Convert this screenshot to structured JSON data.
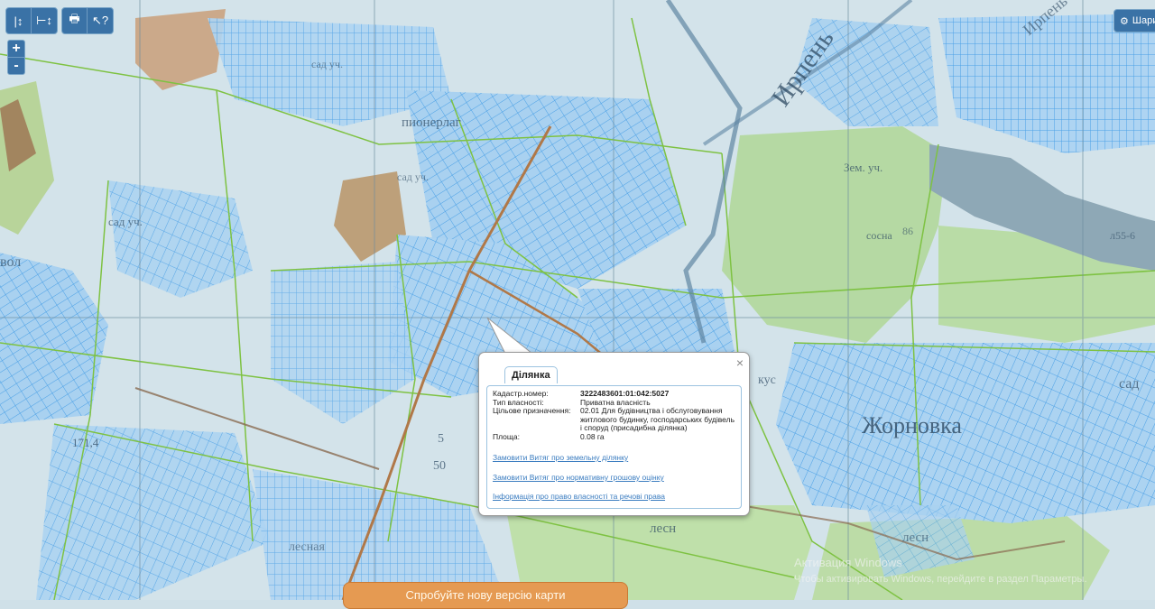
{
  "map": {
    "labels": {
      "river": "Ирпень",
      "river2": "Ирпень",
      "village": "Жорновка",
      "pioneer": "пионерлаг",
      "sad": "сад уч.",
      "sad2": "сад уч.",
      "sad3": "сад уч.",
      "zem": "Зем. уч.",
      "forest": "лесн",
      "forest2": "лесн",
      "sosna": "сосна",
      "elev": "171,4",
      "vol": "вол",
      "n86": "86",
      "n655": "л55-6",
      "sad_r": "сад",
      "kus": "кус",
      "lesn_bottom": "лесная",
      "lab_5": "5",
      "lab_50": "50"
    }
  },
  "toolbar": {
    "ruler": "|↕",
    "ruler2": "⊢↕",
    "print": "🖶",
    "pointer": "↖?"
  },
  "zoom": {
    "in": "+",
    "out": "-"
  },
  "layers": {
    "icon": "⚙",
    "label": "Шари"
  },
  "popup": {
    "close": "×",
    "tab": "Ділянка",
    "rows": [
      {
        "label": "Кадастр.номер:",
        "value": "3222483601:01:042:5027"
      },
      {
        "label": "Тип власності:",
        "value": "Приватна власність"
      },
      {
        "label": "Цільове призначення:",
        "value": "02.01 Для будівництва і обслуговування житлового будинку, господарських будівель і споруд (присадибна ділянка)"
      },
      {
        "label": "Площа:",
        "value": "0.08 га"
      }
    ],
    "links": [
      "Замовити Витяг про земельну ділянку",
      "Замовити Витяг про нормативну грошову оцінку",
      "Інформація про право власності та речові права"
    ]
  },
  "promo": {
    "label": "Спробуйте нову версію карти"
  },
  "watermark": {
    "line1": "Активация Windows",
    "line2": "Чтобы активировать Windows, перейдите в раздел Параметры."
  }
}
